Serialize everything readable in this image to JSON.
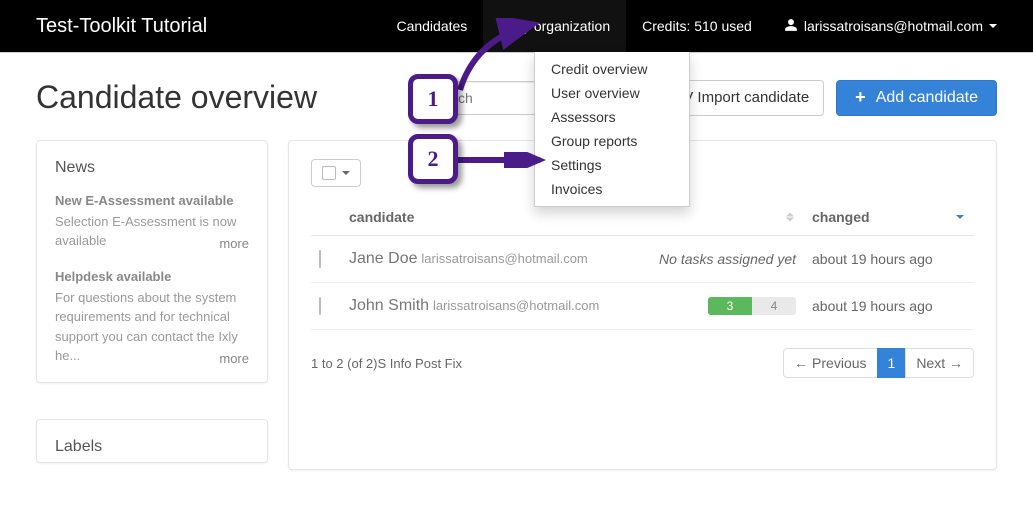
{
  "brand": "Test-Toolkit Tutorial",
  "nav": {
    "candidates": "Candidates",
    "my_org": "My organization",
    "credits": "Credits: 510 used",
    "user": "larissatroisans@hotmail.com"
  },
  "dropdown": [
    "Credit overview",
    "User overview",
    "Assessors",
    "Group reports",
    "Settings",
    "Invoices"
  ],
  "page_title": "Candidate overview",
  "search_placeholder": "Search",
  "btn_csv": "CSV Import candidate",
  "btn_add": "Add candidate",
  "sidebar": {
    "news_heading": "News",
    "news": [
      {
        "title": "New E-Assessment available",
        "body": "Selection E-Assessment is now available",
        "more": "more"
      },
      {
        "title": "Helpdesk available",
        "body": "For questions about the system requirements and for technical support you can contact the Ixly he...",
        "more": "more"
      }
    ],
    "labels_heading": "Labels"
  },
  "table": {
    "col_candidate": "candidate",
    "col_changed": "changed",
    "rows": [
      {
        "name": "Jane Doe",
        "email": "larissatroisans@hotmail.com",
        "tasks_text": "No tasks assigned yet",
        "tasks_green": null,
        "tasks_gray": null,
        "changed": "about 19 hours ago"
      },
      {
        "name": "John Smith",
        "email": "larissatroisans@hotmail.com",
        "tasks_text": null,
        "tasks_green": "3",
        "tasks_gray": "4",
        "changed": "about 19 hours ago"
      }
    ],
    "footer_info": "1 to 2 (of 2)S Info Post Fix",
    "prev": "← Previous",
    "page1": "1",
    "next": "Next →"
  },
  "annotations": {
    "step1": "1",
    "step2": "2"
  }
}
